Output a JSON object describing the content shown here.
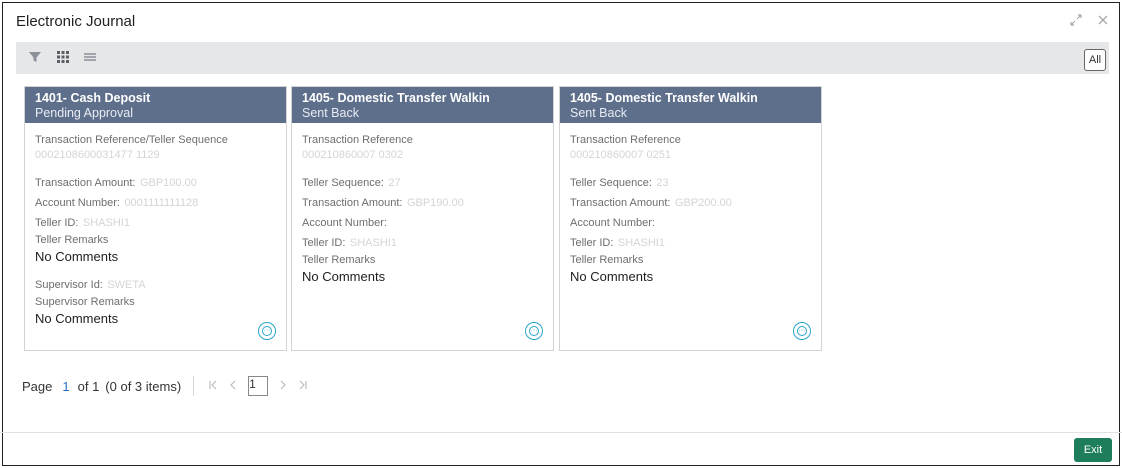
{
  "window": {
    "title": "Electronic Journal"
  },
  "toolbar": {
    "all_label": "All"
  },
  "cards": [
    {
      "title": "1401- Cash Deposit",
      "status": "Pending Approval",
      "fields": [
        {
          "label": "Transaction Reference/Teller Sequence",
          "value": "0002108600031477 1129"
        },
        {
          "label": "Transaction Amount:",
          "value": "GBP100.00"
        },
        {
          "label": "Account Number:",
          "value": "0001111111128"
        },
        {
          "label": "Teller ID:",
          "value": "SHASHI1"
        }
      ],
      "teller_remarks_label": "Teller Remarks",
      "teller_remarks": "No Comments",
      "supervisor_id_label": "Supervisor Id:",
      "supervisor_id": "SWETA",
      "supervisor_remarks_label": "Supervisor Remarks",
      "supervisor_remarks": "No Comments"
    },
    {
      "title": "1405- Domestic Transfer Walkin",
      "status": "Sent Back",
      "reference_label": "Transaction Reference",
      "reference_value": "000210860007 0302",
      "teller_seq_label": "Teller Sequence:",
      "teller_seq_value": "27",
      "amount_label": "Transaction Amount:",
      "amount_value": "GBP190.00",
      "account_label": "Account Number:",
      "account_value": "",
      "teller_id_label": "Teller ID:",
      "teller_id_value": "SHASHI1",
      "teller_remarks_label": "Teller Remarks",
      "teller_remarks": "No Comments"
    },
    {
      "title": "1405- Domestic Transfer Walkin",
      "status": "Sent Back",
      "reference_label": "Transaction Reference",
      "reference_value": "000210860007 0251",
      "teller_seq_label": "Teller Sequence:",
      "teller_seq_value": "23",
      "amount_label": "Transaction Amount:",
      "amount_value": "GBP200.00",
      "account_label": "Account Number:",
      "account_value": "",
      "teller_id_label": "Teller ID:",
      "teller_id_value": "SHASHI1",
      "teller_remarks_label": "Teller Remarks",
      "teller_remarks": "No Comments"
    }
  ],
  "pager": {
    "page_label": "Page",
    "current_page": "1",
    "of_label": "of 1",
    "items_label": "(0 of 3 items)",
    "box_page": "1"
  },
  "footer": {
    "exit_label": "Exit"
  },
  "colors": {
    "card_header": "#5e6f8c",
    "exit": "#1e7d5a",
    "accent": "#2aa6c9"
  }
}
